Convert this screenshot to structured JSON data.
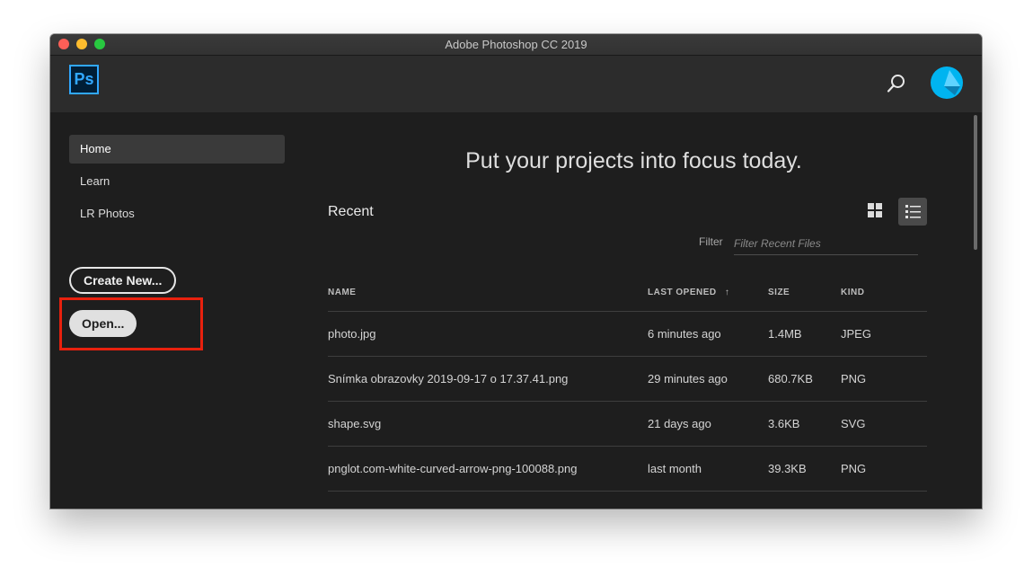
{
  "window": {
    "title": "Adobe Photoshop CC 2019"
  },
  "header": {
    "logo_text": "Ps",
    "search_icon": "search-icon",
    "avatar_icon": "user-avatar"
  },
  "colors": {
    "brand": "#31a8ff",
    "highlight": "#e8210e",
    "background": "#1e1e1e"
  },
  "sidebar": {
    "items": [
      {
        "label": "Home",
        "active": true
      },
      {
        "label": "Learn",
        "active": false
      },
      {
        "label": "LR Photos",
        "active": false
      }
    ],
    "create_label": "Create New...",
    "open_label": "Open..."
  },
  "main": {
    "headline": "Put your projects into focus today.",
    "recent_title": "Recent",
    "filter_label": "Filter",
    "filter_placeholder": "Filter Recent Files",
    "view_icons": [
      "grid-view-icon",
      "list-view-icon"
    ],
    "columns": [
      "NAME",
      "LAST OPENED",
      "SIZE",
      "KIND"
    ],
    "sort_indicator": "↑",
    "files": [
      {
        "name": "photo.jpg",
        "opened": "6 minutes ago",
        "size": "1.4MB",
        "kind": "JPEG"
      },
      {
        "name": "Snímka obrazovky 2019-09-17 o 17.37.41.png",
        "opened": "29 minutes ago",
        "size": "680.7KB",
        "kind": "PNG"
      },
      {
        "name": "shape.svg",
        "opened": "21 days ago",
        "size": "3.6KB",
        "kind": "SVG"
      },
      {
        "name": "pnglot.com-white-curved-arrow-png-100088.png",
        "opened": "last month",
        "size": "39.3KB",
        "kind": "PNG"
      }
    ]
  }
}
